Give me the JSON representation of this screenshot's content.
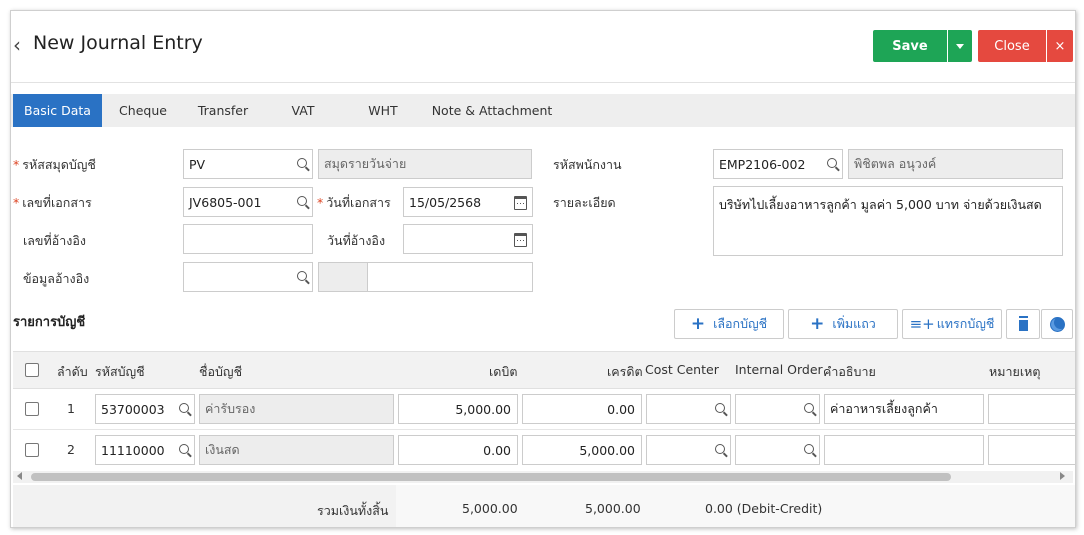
{
  "header": {
    "title": "New Journal Entry",
    "save_label": "Save",
    "close_label": "Close"
  },
  "tabs": [
    "Basic Data",
    "Cheque",
    "Transfer",
    "VAT",
    "WHT",
    "Note & Attachment"
  ],
  "form": {
    "journal_code_label": "รหัสสมุดบัญชี",
    "journal_code_value": "PV",
    "journal_name_value": "สมุดรายวันจ่าย",
    "doc_no_label": "เลขที่เอกสาร",
    "doc_no_value": "JV6805-001",
    "doc_date_label": "วันที่เอกสาร",
    "doc_date_value": "15/05/2568",
    "ref_no_label": "เลขที่อ้างอิง",
    "ref_no_value": "",
    "ref_date_label": "วันที่อ้างอิง",
    "ref_date_value": "",
    "ref_info_label": "ข้อมูลอ้างอิง",
    "employee_code_label": "รหัสพนักงาน",
    "employee_code_value": "EMP2106-002",
    "employee_name_value": "พิชิตพล อนุวงค์",
    "detail_label": "รายละเอียด",
    "detail_value": "บริษัทไปเลี้ยงอาหารลูกค้า มูลค่า 5,000 บาท จ่ายด้วยเงินสด"
  },
  "accounts": {
    "section_title": "รายการบัญชี",
    "btn_select": "เลือกบัญชี",
    "btn_add_row": "เพิ่มแถว",
    "btn_insert": "แทรกบัญชี",
    "columns": {
      "seq": "ลำดับ",
      "code": "รหัสบัญชี",
      "name": "ชื่อบัญชี",
      "debit": "เดบิต",
      "credit": "เครดิต",
      "cost_center": "Cost Center",
      "internal_order": "Internal Order",
      "description": "คำอธิบาย",
      "remark": "หมายเหตุ"
    },
    "rows": [
      {
        "seq": "1",
        "code": "53700003",
        "name": "ค่ารับรอง",
        "debit": "5,000.00",
        "credit": "0.00",
        "description": "ค่าอาหารเลี้ยงลูกค้า"
      },
      {
        "seq": "2",
        "code": "11110000",
        "name": "เงินสด",
        "debit": "0.00",
        "credit": "5,000.00",
        "description": ""
      }
    ],
    "totals": {
      "label": "รวมเงินทั้งสิ้น",
      "debit": "5,000.00",
      "credit": "5,000.00",
      "diff": "0.00 (Debit-Credit)"
    }
  },
  "colors": {
    "primary": "#2a72c4",
    "save": "#1ea556",
    "close": "#e5493f"
  }
}
